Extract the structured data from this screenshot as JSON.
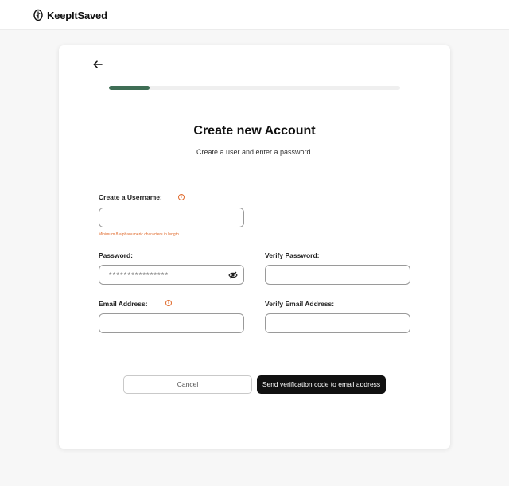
{
  "app": {
    "name": "KeepItSaved",
    "logo_icon": "seed-leaf-icon"
  },
  "navigation": {
    "back_icon": "arrow-left-icon"
  },
  "progress": {
    "fraction": 0.14,
    "color": "#3f6e55"
  },
  "header": {
    "title": "Create new Account",
    "subtitle": "Create a user and enter a password."
  },
  "form": {
    "username": {
      "label": "Create a Username:",
      "value": "",
      "hint": "Minimum 8 alphanumeric characters in length.",
      "info_icon": "info-icon"
    },
    "password": {
      "label": "Password:",
      "value": "****************",
      "toggle_icon": "eye-slash-icon"
    },
    "verify_password": {
      "label": "Verify Password:",
      "value": ""
    },
    "email": {
      "label": "Email Address:",
      "value": "",
      "info_icon": "info-icon"
    },
    "verify_email": {
      "label": "Verify Email Address:",
      "value": ""
    }
  },
  "actions": {
    "cancel_label": "Cancel",
    "submit_label": "Send verification code to email address"
  },
  "colors": {
    "accent": "#3f6e55",
    "warning": "#e06a2c",
    "primary_button": "#111111"
  }
}
